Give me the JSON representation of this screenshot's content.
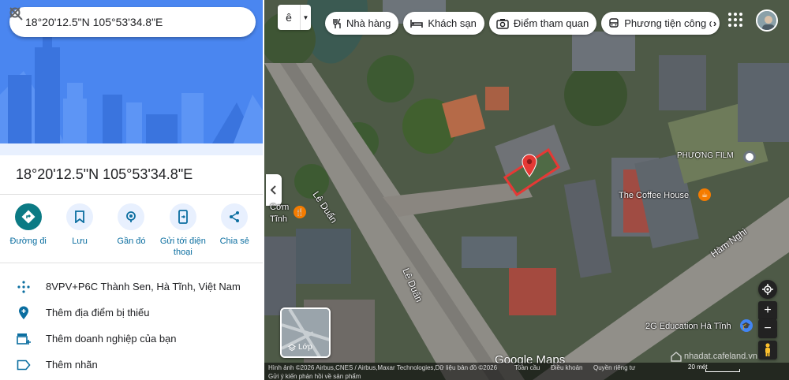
{
  "search": {
    "query": "18°20'12.5\"N 105°53'34.8\"E"
  },
  "place": {
    "title": "18°20'12.5\"N 105°53'34.8\"E"
  },
  "actions": [
    {
      "label": "Đường đi",
      "icon": "directions-icon"
    },
    {
      "label": "Lưu",
      "icon": "bookmark-icon"
    },
    {
      "label": "Gần đó",
      "icon": "nearby-icon"
    },
    {
      "label": "Gửi tới điện thoại",
      "icon": "send-to-phone-icon"
    },
    {
      "label": "Chia sẻ",
      "icon": "share-icon"
    }
  ],
  "info": [
    {
      "text": "8VPV+P6C Thành Sen, Hà Tĩnh, Việt Nam",
      "icon": "plus-code-icon"
    },
    {
      "text": "Thêm địa điểm bị thiếu",
      "icon": "add-place-icon"
    },
    {
      "text": "Thêm doanh nghiệp của bạn",
      "icon": "add-business-icon"
    },
    {
      "text": "Thêm nhãn",
      "icon": "label-icon"
    }
  ],
  "map": {
    "lang_label": "ê",
    "chips": [
      {
        "label": "Nhà hàng",
        "icon": "restaurant-icon"
      },
      {
        "label": "Khách sạn",
        "icon": "hotel-icon"
      },
      {
        "label": "Điểm tham quan",
        "icon": "camera-icon"
      },
      {
        "label": "Phương tiện công cộng",
        "icon": "transit-icon"
      }
    ],
    "labels": {
      "phuong_film": "PHƯỢNG FILM",
      "coffee_house": "The Coffee House",
      "com": "Cơm",
      "tinh": "Tĩnh",
      "le_duan_1": "Lê Duẩn",
      "le_duan_2": "Lê Duẩn",
      "ham_nghi": "Hàm Nghi",
      "education": "2G Education Hà Tĩnh"
    },
    "layers_label": "Lớp",
    "google_maps": "Google Maps",
    "watermark": "nhadat.cafeland.vn",
    "footer": {
      "imagery": "Hình ảnh ©2026 Airbus,CNES / Airbus,Maxar Technologies,Dữ liệu bản đồ ©2026",
      "global": "Toàn cầu",
      "terms": "Điều khoản",
      "privacy": "Quyền riêng tư",
      "feedback": "Gửi ý kiến phản hồi về sản phẩm",
      "scale": "20 mét"
    },
    "colors": {
      "pin": "#e53935",
      "teal": "#0b7a84",
      "poi_orange": "#f57c00"
    }
  }
}
